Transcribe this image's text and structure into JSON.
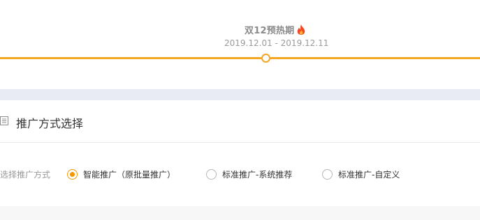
{
  "timeline": {
    "phase_title": "双12预热期",
    "phase_dates": "2019.12.01 - 2019.12.11",
    "fire_icon": "fire-icon",
    "accent_color": "#f5a623"
  },
  "section": {
    "title": "推广方式选择",
    "icon": "list-icon",
    "field_label": "选择推广方式",
    "options": [
      {
        "label": "智能推广（原批量推广）",
        "checked": true
      },
      {
        "label": "标准推广-系统推荐",
        "checked": false
      },
      {
        "label": "标准推广-自定义",
        "checked": false
      }
    ],
    "radio_checked_color": "#f39800"
  }
}
